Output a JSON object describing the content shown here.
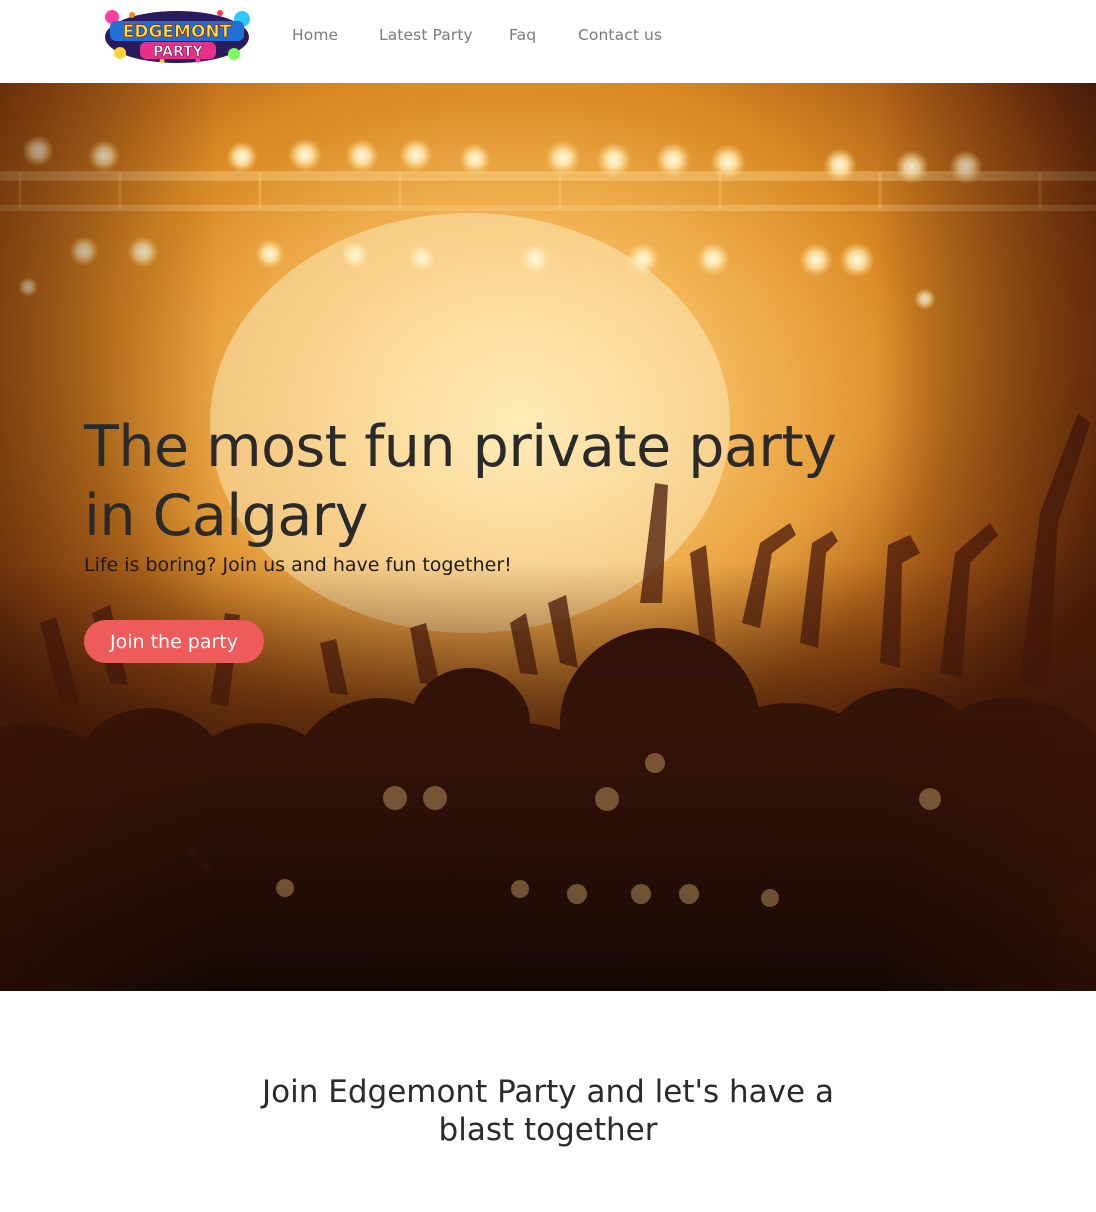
{
  "header": {
    "logo": {
      "alt": "Edgemont Party",
      "line1": "EDGEMONT",
      "line2": "PARTY"
    },
    "nav": [
      {
        "label": "Home"
      },
      {
        "label": "Latest Party"
      },
      {
        "label": "Faq"
      },
      {
        "label": "Contact us"
      }
    ]
  },
  "hero": {
    "title": "The most fun private party in Calgary",
    "subtitle": "Life is boring? Join us and have fun together!",
    "cta_label": "Join the party"
  },
  "intro": {
    "title": "Join Edgemont Party and let's have a blast together"
  },
  "colors": {
    "cta_bg": "#ee5b5b",
    "nav_text": "#7b7b7b",
    "hero_glow": "#f2b04a"
  }
}
